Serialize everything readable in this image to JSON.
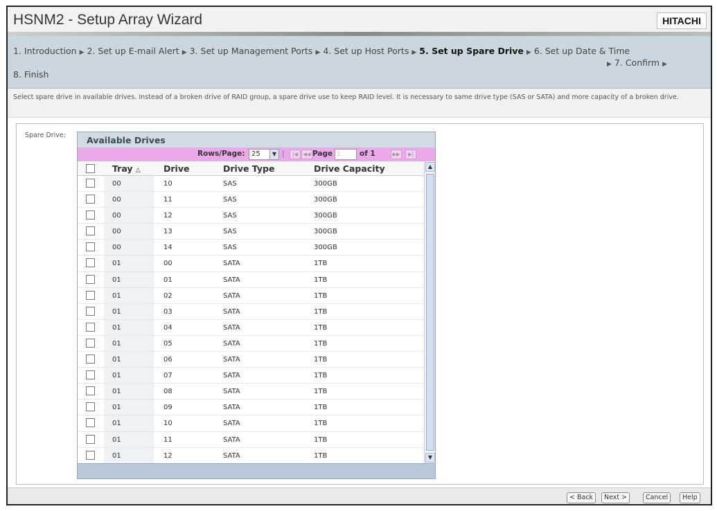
{
  "window": {
    "title": "HSNM2 - Setup Array Wizard",
    "logo": "HITACHI"
  },
  "steps": {
    "items": [
      "1. Introduction",
      "2. Set up E-mail Alert",
      "3. Set up Management Ports",
      "4. Set up Host Ports",
      "5. Set up Spare Drive",
      "6. Set up Date & Time",
      "7. Confirm",
      "8. Finish"
    ],
    "current_index": 4
  },
  "description": "Select spare drive in available drives. Instead of a broken drive of RAID group, a spare drive use to keep RAID level. It is necessary to same drive type (SAS or SATA) and more capacity of a broken drive.",
  "spare_drive_label": "Spare Drive:",
  "grid": {
    "title": "Available Drives",
    "rows_per_page_label": "Rows/Page:",
    "rows_per_page_value": "25",
    "page_label": "Page",
    "page_input_value": "1",
    "of_label": "of 1",
    "columns": [
      "Tray",
      "Drive",
      "Drive Type",
      "Drive Capacity"
    ],
    "rows": [
      {
        "tray": "00",
        "drive": "10",
        "type": "SAS",
        "capacity": "300GB"
      },
      {
        "tray": "00",
        "drive": "11",
        "type": "SAS",
        "capacity": "300GB"
      },
      {
        "tray": "00",
        "drive": "12",
        "type": "SAS",
        "capacity": "300GB"
      },
      {
        "tray": "00",
        "drive": "13",
        "type": "SAS",
        "capacity": "300GB"
      },
      {
        "tray": "00",
        "drive": "14",
        "type": "SAS",
        "capacity": "300GB"
      },
      {
        "tray": "01",
        "drive": "00",
        "type": "SATA",
        "capacity": "1TB"
      },
      {
        "tray": "01",
        "drive": "01",
        "type": "SATA",
        "capacity": "1TB"
      },
      {
        "tray": "01",
        "drive": "02",
        "type": "SATA",
        "capacity": "1TB"
      },
      {
        "tray": "01",
        "drive": "03",
        "type": "SATA",
        "capacity": "1TB"
      },
      {
        "tray": "01",
        "drive": "04",
        "type": "SATA",
        "capacity": "1TB"
      },
      {
        "tray": "01",
        "drive": "05",
        "type": "SATA",
        "capacity": "1TB"
      },
      {
        "tray": "01",
        "drive": "06",
        "type": "SATA",
        "capacity": "1TB"
      },
      {
        "tray": "01",
        "drive": "07",
        "type": "SATA",
        "capacity": "1TB"
      },
      {
        "tray": "01",
        "drive": "08",
        "type": "SATA",
        "capacity": "1TB"
      },
      {
        "tray": "01",
        "drive": "09",
        "type": "SATA",
        "capacity": "1TB"
      },
      {
        "tray": "01",
        "drive": "10",
        "type": "SATA",
        "capacity": "1TB"
      },
      {
        "tray": "01",
        "drive": "11",
        "type": "SATA",
        "capacity": "1TB"
      },
      {
        "tray": "01",
        "drive": "12",
        "type": "SATA",
        "capacity": "1TB"
      }
    ]
  },
  "buttons": {
    "back": "< Back",
    "next": "Next >",
    "cancel": "Cancel",
    "help": "Help"
  },
  "icons": {
    "step_separator": "triangle-right-icon",
    "sort": "sort-ascending-icon",
    "dropdown": "chevron-down-icon",
    "first_page": "first-page-icon",
    "prev_page": "previous-page-icon",
    "next_page": "next-page-icon",
    "last_page": "last-page-icon"
  },
  "colors": {
    "step_bar": "#cbd7de",
    "pager_bar": "#eaaaea",
    "grid_title": "#d0dbe4"
  }
}
